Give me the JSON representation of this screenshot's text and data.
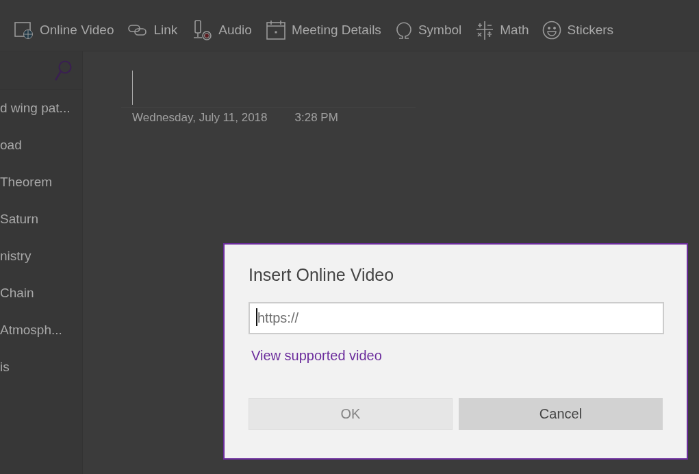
{
  "toolbar": {
    "items": [
      {
        "kind": "video",
        "label": "Online Video"
      },
      {
        "kind": "link",
        "label": "Link"
      },
      {
        "kind": "audio",
        "label": "Audio"
      },
      {
        "kind": "meeting",
        "label": "Meeting Details"
      },
      {
        "kind": "symbol",
        "label": "Symbol"
      },
      {
        "kind": "math",
        "label": "Math"
      },
      {
        "kind": "stickers",
        "label": "Stickers"
      }
    ]
  },
  "sidebar": {
    "pages": [
      "d wing pat...",
      "oad",
      "Theorem",
      "Saturn",
      "nistry",
      "Chain",
      "Atmosph...",
      "is"
    ]
  },
  "note": {
    "date": "Wednesday, July 11, 2018",
    "time": "3:28 PM"
  },
  "dialog": {
    "title": "Insert Online Video",
    "placeholder": "https://",
    "link": "View supported video",
    "buttons": [
      {
        "label": "OK",
        "disabled": true
      },
      {
        "label": "Cancel",
        "disabled": false
      }
    ]
  }
}
